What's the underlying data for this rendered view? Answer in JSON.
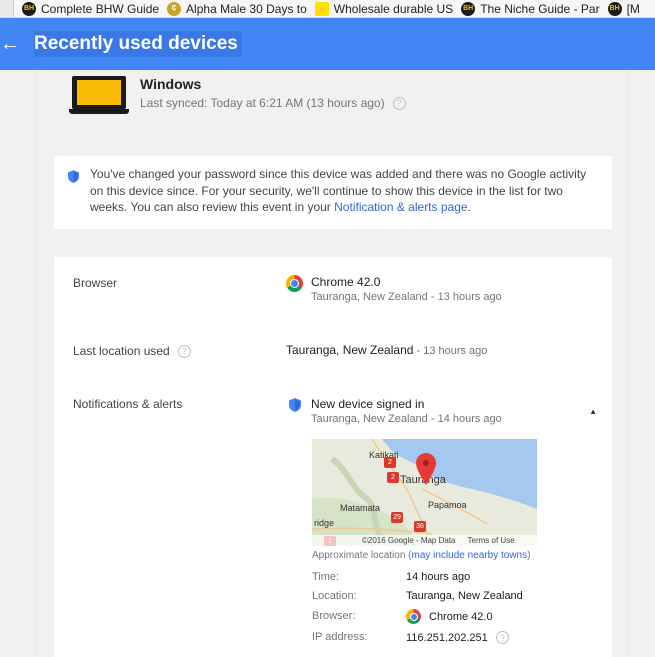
{
  "bookmarks": [
    {
      "label": "Complete BHW Guide",
      "icon": "bhw-icon"
    },
    {
      "label": "Alpha Male 30 Days to",
      "icon": "coin-icon"
    },
    {
      "label": "Wholesale durable US",
      "icon": "aliexpress-icon"
    },
    {
      "label": "The Niche Guide - Par",
      "icon": "bhw-icon"
    },
    {
      "label": "[M",
      "icon": "bhw-icon"
    }
  ],
  "header": {
    "back_icon": "arrow-left-icon",
    "title": "Recently used devices"
  },
  "device": {
    "name": "Windows",
    "sync": "Last synced: Today at 6:21 AM (13 hours ago)"
  },
  "notice": {
    "text": "You've changed your password since this device was added and there was no Google activity on this device since. For your security, we'll continue to show this device in the list for two weeks. You can also review this event in your ",
    "link": "Notification & alerts page",
    "end": "."
  },
  "details": {
    "browser_label": "Browser",
    "browser_value": "Chrome 42.0",
    "browser_sub": "Tauranga, New Zealand - 13 hours ago",
    "location_label": "Last location used",
    "location_value": "Tauranga, New Zealand",
    "location_sub": " - 13 hours ago",
    "alerts_label": "Notifications & alerts",
    "alert_title": "New device signed in",
    "alert_sub": "Tauranga, New Zealand - 14 hours ago"
  },
  "map": {
    "labels": [
      "Katikati",
      "Tauranga",
      "Papamoa",
      "Matamata",
      "ridge"
    ],
    "routes": [
      "2",
      "2",
      "29",
      "36",
      "1"
    ],
    "copyright": "©2016 Google - Map Data",
    "terms": "Terms of Use",
    "approx": "Approximate location (",
    "approx_link": "may include nearby towns",
    "approx_end": ")"
  },
  "event": {
    "time_key": "Time:",
    "time_val": "14 hours ago",
    "loc_key": "Location:",
    "loc_val": "Tauranga, New Zealand",
    "browser_key": "Browser:",
    "browser_val": "Chrome 42.0",
    "ip_key": "IP address:",
    "ip_val": "116.251.202.251"
  },
  "colors": {
    "appbar": "#4285f4",
    "link": "#3367d6",
    "laptop_screen": "#fbbc05"
  }
}
